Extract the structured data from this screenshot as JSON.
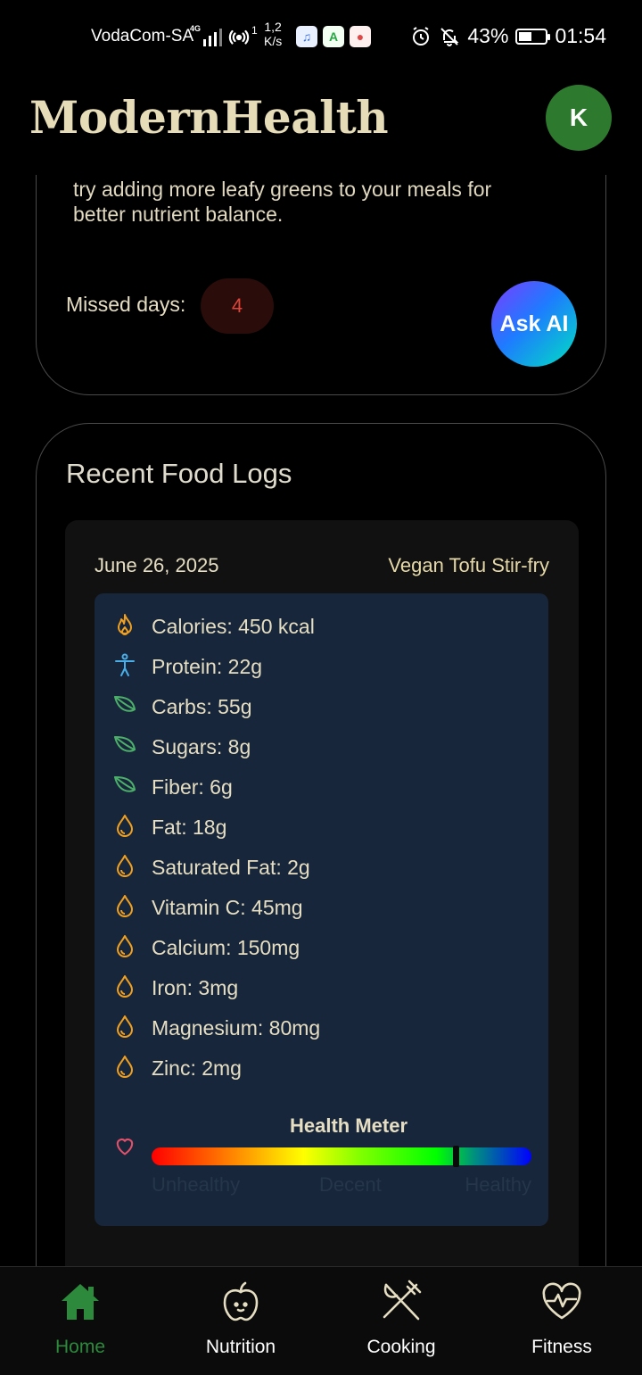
{
  "status_bar": {
    "carrier": "VodaCom-SA",
    "network": "4G",
    "hotspot_sup": "1",
    "speed_top": "1,2",
    "speed_bottom": "K/s",
    "battery": "43%",
    "time": "01:54"
  },
  "header": {
    "app_title": "ModernHealth",
    "avatar_initial": "K"
  },
  "insight_card": {
    "text": "try adding more leafy greens to your meals for better nutrient balance.",
    "missed_label": "Missed days:",
    "missed_value": "4",
    "ask_ai_label": "Ask AI"
  },
  "food_logs": {
    "title": "Recent Food Logs",
    "entry": {
      "date": "June 26, 2025",
      "meal": "Vegan Tofu Stir-fry",
      "nutrients": [
        {
          "icon": "flame-icon",
          "text": "Calories: 450 kcal"
        },
        {
          "icon": "person-icon",
          "text": "Protein: 22g"
        },
        {
          "icon": "leaf-icon",
          "text": "Carbs: 55g"
        },
        {
          "icon": "leaf-icon",
          "text": "Sugars: 8g"
        },
        {
          "icon": "leaf-icon",
          "text": "Fiber: 6g"
        },
        {
          "icon": "drop-icon",
          "text": "Fat: 18g"
        },
        {
          "icon": "drop-icon",
          "text": "Saturated Fat: 2g"
        },
        {
          "icon": "drop-icon",
          "text": "Vitamin C: 45mg"
        },
        {
          "icon": "drop-icon",
          "text": "Calcium: 150mg"
        },
        {
          "icon": "drop-icon",
          "text": "Iron: 3mg"
        },
        {
          "icon": "drop-icon",
          "text": "Magnesium: 80mg"
        },
        {
          "icon": "drop-icon",
          "text": "Zinc: 2mg"
        }
      ],
      "health_meter": {
        "title": "Health Meter",
        "value_percent": 80,
        "label_low": "Unhealthy",
        "label_mid": "Decent",
        "label_high": "Healthy"
      }
    }
  },
  "bottom_nav": {
    "items": [
      {
        "label": "Home",
        "icon": "home-icon",
        "active": true
      },
      {
        "label": "Nutrition",
        "icon": "apple-icon",
        "active": false
      },
      {
        "label": "Cooking",
        "icon": "utensils-icon",
        "active": false
      },
      {
        "label": "Fitness",
        "icon": "heart-pulse-icon",
        "active": false
      }
    ]
  },
  "colors": {
    "accent_green": "#2d7a2e",
    "logo": "#e6dcb8",
    "panel": "#17263a",
    "orange_icon": "#f0a020",
    "blue_icon": "#4aaee8",
    "green_icon": "#4caf6a",
    "missed_red": "#e0453a"
  }
}
